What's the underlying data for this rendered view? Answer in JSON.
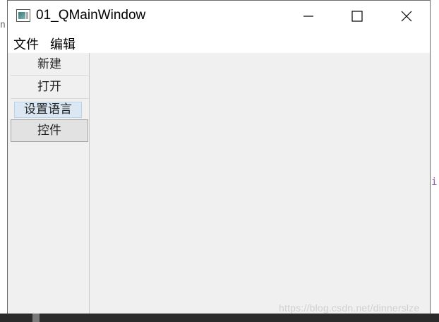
{
  "desktop": {
    "left_text": "n",
    "right_text": "i",
    "watermark": "https://blog.csdn.net/dinnerslze"
  },
  "window": {
    "title": "01_QMainWindow",
    "controls": {
      "minimize": "minimize-icon",
      "maximize": "maximize-icon",
      "close": "close-icon"
    }
  },
  "menubar": {
    "items": [
      "文件",
      "编辑"
    ]
  },
  "sidebar": {
    "items": [
      {
        "label": "新建"
      },
      {
        "label": "打开"
      },
      {
        "label": "设置语言",
        "state": "selected"
      },
      {
        "label": "控件",
        "state": "pressed"
      }
    ]
  },
  "colors": {
    "window_bg": "#f0f0f0",
    "selected_bg": "#dbe8f4",
    "pressed_bg": "#e2e2e2"
  }
}
